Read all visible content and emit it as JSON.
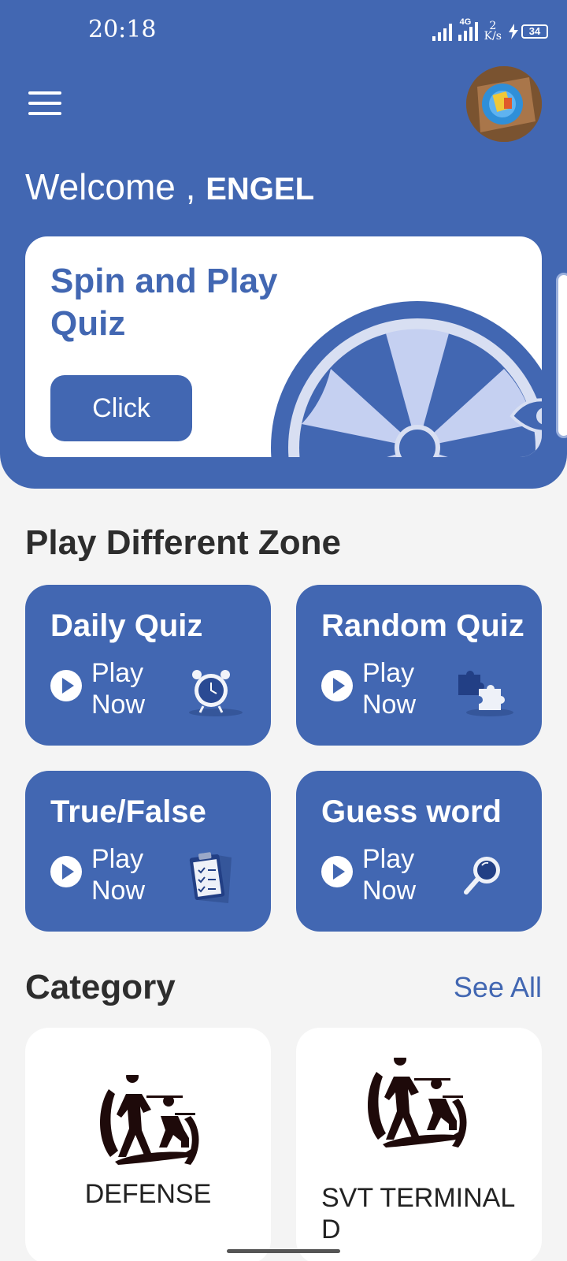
{
  "status_bar": {
    "time": "20:18",
    "network": "4G",
    "speed_value": "2",
    "speed_unit": "K/s",
    "battery": "34"
  },
  "header": {
    "greeting": "Welcome ,",
    "user_name": "ENGEL",
    "menu_icon": "hamburger-icon",
    "avatar_icon": "avatar"
  },
  "spin": {
    "title": "Spin and Play Quiz",
    "button": "Click"
  },
  "zones": {
    "title": "Play Different Zone",
    "items": [
      {
        "name": "Daily Quiz",
        "play_line1": "Play",
        "play_line2": "Now",
        "icon": "alarm-clock-icon"
      },
      {
        "name": "Random Quiz",
        "play_line1": "Play",
        "play_line2": "Now",
        "icon": "puzzle-icon"
      },
      {
        "name": "True/False",
        "play_line1": "Play",
        "play_line2": "Now",
        "icon": "clipboard-icon"
      },
      {
        "name": "Guess word",
        "play_line1": "Play",
        "play_line2": "Now",
        "icon": "magnifier-icon"
      }
    ]
  },
  "category": {
    "title": "Category",
    "see_all": "See All",
    "items": [
      {
        "label": "DEFENSE",
        "icon": "soldiers-icon"
      },
      {
        "label": "SVT TERMINAL D",
        "icon": "soldiers-icon"
      }
    ]
  },
  "colors": {
    "primary": "#4267b2",
    "background": "#f4f4f4",
    "card": "#ffffff"
  }
}
